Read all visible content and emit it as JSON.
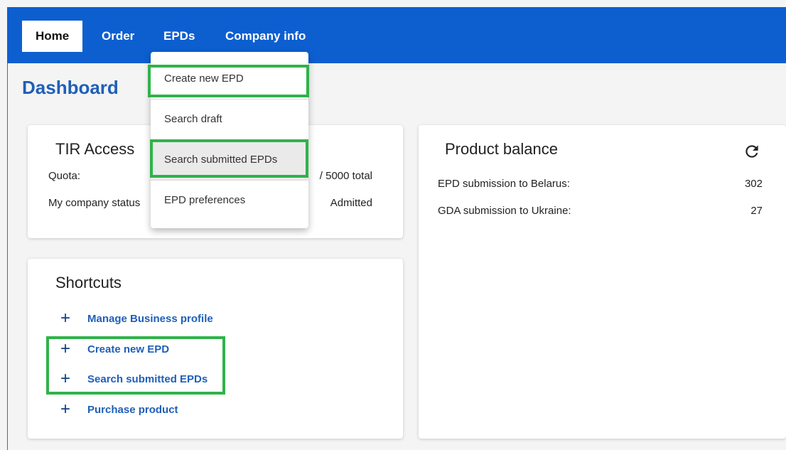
{
  "nav": {
    "items": [
      {
        "label": "Home",
        "active": true
      },
      {
        "label": "Order"
      },
      {
        "label": "EPDs"
      },
      {
        "label": "Company info"
      }
    ]
  },
  "page": {
    "title": "Dashboard"
  },
  "tir_card": {
    "title": "TIR Access",
    "quota_label": "Quota:",
    "quota_value": "/ 5000 total",
    "status_label": "My company status",
    "status_value": "Admitted"
  },
  "product_card": {
    "title": "Product balance",
    "refresh_icon": "refresh-icon",
    "rows": [
      {
        "label": "EPD submission to Belarus:",
        "value": "302"
      },
      {
        "label": "GDA submission to Ukraine:",
        "value": "27"
      }
    ]
  },
  "shortcuts_card": {
    "title": "Shortcuts",
    "items": [
      {
        "label": "Manage Business profile",
        "icon": "plus-icon"
      },
      {
        "label": "Create new EPD",
        "icon": "plus-icon"
      },
      {
        "label": "Search submitted EPDs",
        "icon": "plus-icon"
      },
      {
        "label": "Purchase product",
        "icon": "plus-icon"
      }
    ]
  },
  "epd_menu": {
    "items": [
      {
        "label": "Create new EPD"
      },
      {
        "label": "Search draft"
      },
      {
        "label": "Search submitted EPDs",
        "hovered": true
      },
      {
        "label": "EPD preferences"
      }
    ]
  },
  "colors": {
    "nav_bg": "#0d5fd0",
    "title": "#1f5fb8",
    "link": "#1f5fb8",
    "highlight": "#2fb34a"
  }
}
